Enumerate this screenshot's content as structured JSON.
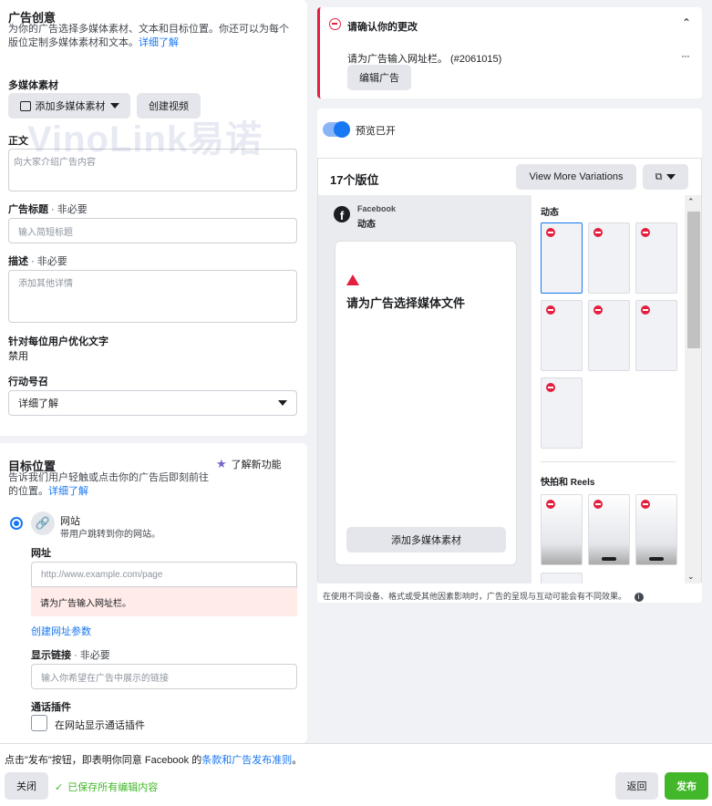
{
  "creative": {
    "title": "广告创意",
    "desc": "为你的广告选择多媒体素材、文本和目标位置。你还可以为每个版位定制多媒体素材和文本。",
    "learn_more": "详细了解",
    "media_label": "多媒体素材",
    "add_media_btn": "添加多媒体素材",
    "create_video_btn": "创建视频",
    "body_label": "正文",
    "body_placeholder": "向大家介绍广告内容",
    "headline_label": "广告标题",
    "headline_optional": " · 非必要",
    "headline_placeholder": "输入简短标题",
    "desc_label": "描述",
    "desc_optional": " · 非必要",
    "desc_placeholder": "添加其他详情",
    "optimize_label": "针对每位用户优化文字",
    "optimize_value": "禁用",
    "cta_label": "行动号召",
    "cta_value": "详细了解"
  },
  "destination": {
    "title": "目标位置",
    "new_feature": "了解新功能",
    "desc": "告诉我们用户轻触或点击你的广告后即刻前往的位置。",
    "learn_more": "详细了解",
    "website_label": "网站",
    "website_sub": "带用户跳转到你的网站。",
    "url_label": "网址",
    "url_placeholder": "http://www.example.com/page",
    "url_error": "请为广告输入网址栏。",
    "url_params_link": "创建网址参数",
    "display_link_label": "显示链接",
    "display_link_optional": " · 非必要",
    "display_link_placeholder": "输入你希望在广告中展示的链接",
    "call_plugin_label": "通话插件",
    "call_plugin_checkbox": "在网站显示通话插件"
  },
  "alert": {
    "title": "请确认你的更改",
    "message": "请为广告输入网址栏。 (#2061015)",
    "edit_btn": "编辑广告",
    "more": "···"
  },
  "preview": {
    "toggle_label": "预览已开",
    "count_label": "17个版位",
    "view_more_btn": "View More Variations",
    "platform": "Facebook",
    "placement": "动态",
    "warning": "请为广告选择媒体文件",
    "add_media_btn": "添加多媒体素材",
    "section_feed": "动态",
    "section_reels": "快拍和 Reels",
    "disclaimer": "在使用不同设备、格式或受其他因素影响时，广告的呈现与互动可能会有不同效果。"
  },
  "footer": {
    "agree_text_1": "点击\"发布\"按钮，即表明你同意 Facebook 的",
    "agree_link": "条款和广告发布准则",
    "agree_text_2": "。",
    "close_btn": "关闭",
    "saved_text": "已保存所有编辑内容",
    "back_btn": "返回",
    "publish_btn": "发布"
  },
  "watermark": "VinoLink易诺",
  "colors": {
    "accent": "#1877f2",
    "error": "#e41e3f",
    "publish": "#42b72a"
  }
}
